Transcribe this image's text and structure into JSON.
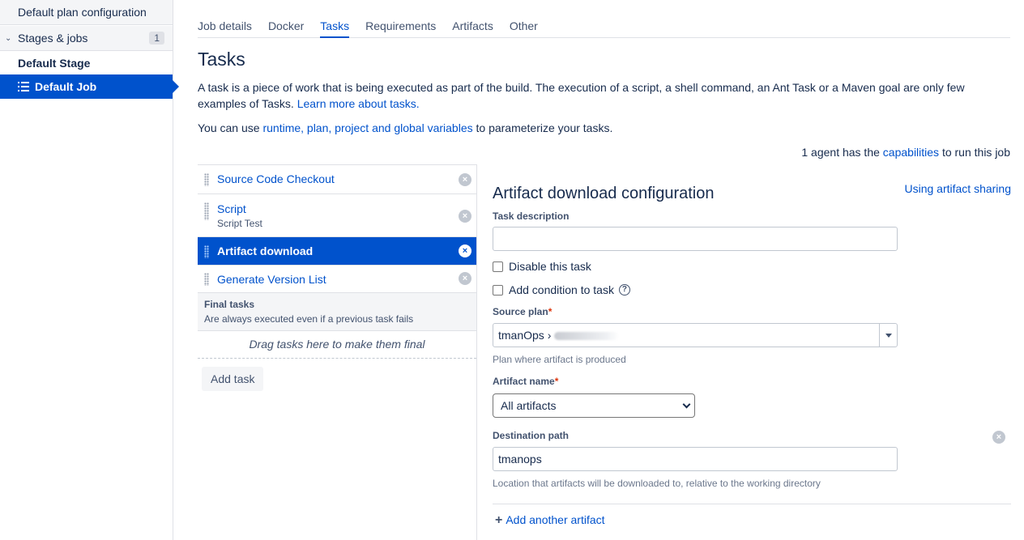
{
  "sidebar": {
    "plan_config": "Default plan configuration",
    "stages_label": "Stages & jobs",
    "stages_count": "1",
    "stage_name": "Default Stage",
    "job_name": "Default Job"
  },
  "tabs": [
    {
      "label": "Job details"
    },
    {
      "label": "Docker"
    },
    {
      "label": "Tasks"
    },
    {
      "label": "Requirements"
    },
    {
      "label": "Artifacts"
    },
    {
      "label": "Other"
    }
  ],
  "page_title": "Tasks",
  "intro": {
    "text": "A task is a piece of work that is being executed as part of the build. The execution of a script, a shell command, an Ant Task or a Maven goal are only few examples of Tasks. ",
    "learn_more": "Learn more about tasks.",
    "vars_prefix": "You can use ",
    "vars_link": "runtime, plan, project and global variables",
    "vars_suffix": " to parameterize your tasks."
  },
  "agents": {
    "prefix": "1 agent has the ",
    "link": "capabilities",
    "suffix": " to run this job"
  },
  "tasks": [
    {
      "name": "Source Code Checkout",
      "sub": ""
    },
    {
      "name": "Script",
      "sub": "Script Test"
    },
    {
      "name": "Artifact download",
      "sub": ""
    },
    {
      "name": "Generate Version List",
      "sub": ""
    }
  ],
  "final_tasks": {
    "title": "Final tasks",
    "subtitle": "Are always executed even if a previous task fails",
    "dropzone": "Drag tasks here to make them final"
  },
  "add_task_label": "Add task",
  "config": {
    "title": "Artifact download configuration",
    "sharing_link": "Using artifact sharing",
    "task_description_label": "Task description",
    "task_description_value": "",
    "disable_label": "Disable this task",
    "condition_label": "Add condition to task",
    "source_plan_label": "Source plan",
    "source_plan_value": "tmanOps ›",
    "source_plan_hint": "Plan where artifact is produced",
    "artifact_name_label": "Artifact name",
    "artifact_name_value": "All artifacts",
    "destination_label": "Destination path",
    "destination_value": "tmanops",
    "destination_hint": "Location that artifacts will be downloaded to, relative to the working directory",
    "add_artifact": "Add another artifact",
    "required_mark": "*"
  },
  "icons": {
    "remove": "×",
    "help": "?",
    "plus": "+",
    "chevron": "⌄"
  }
}
